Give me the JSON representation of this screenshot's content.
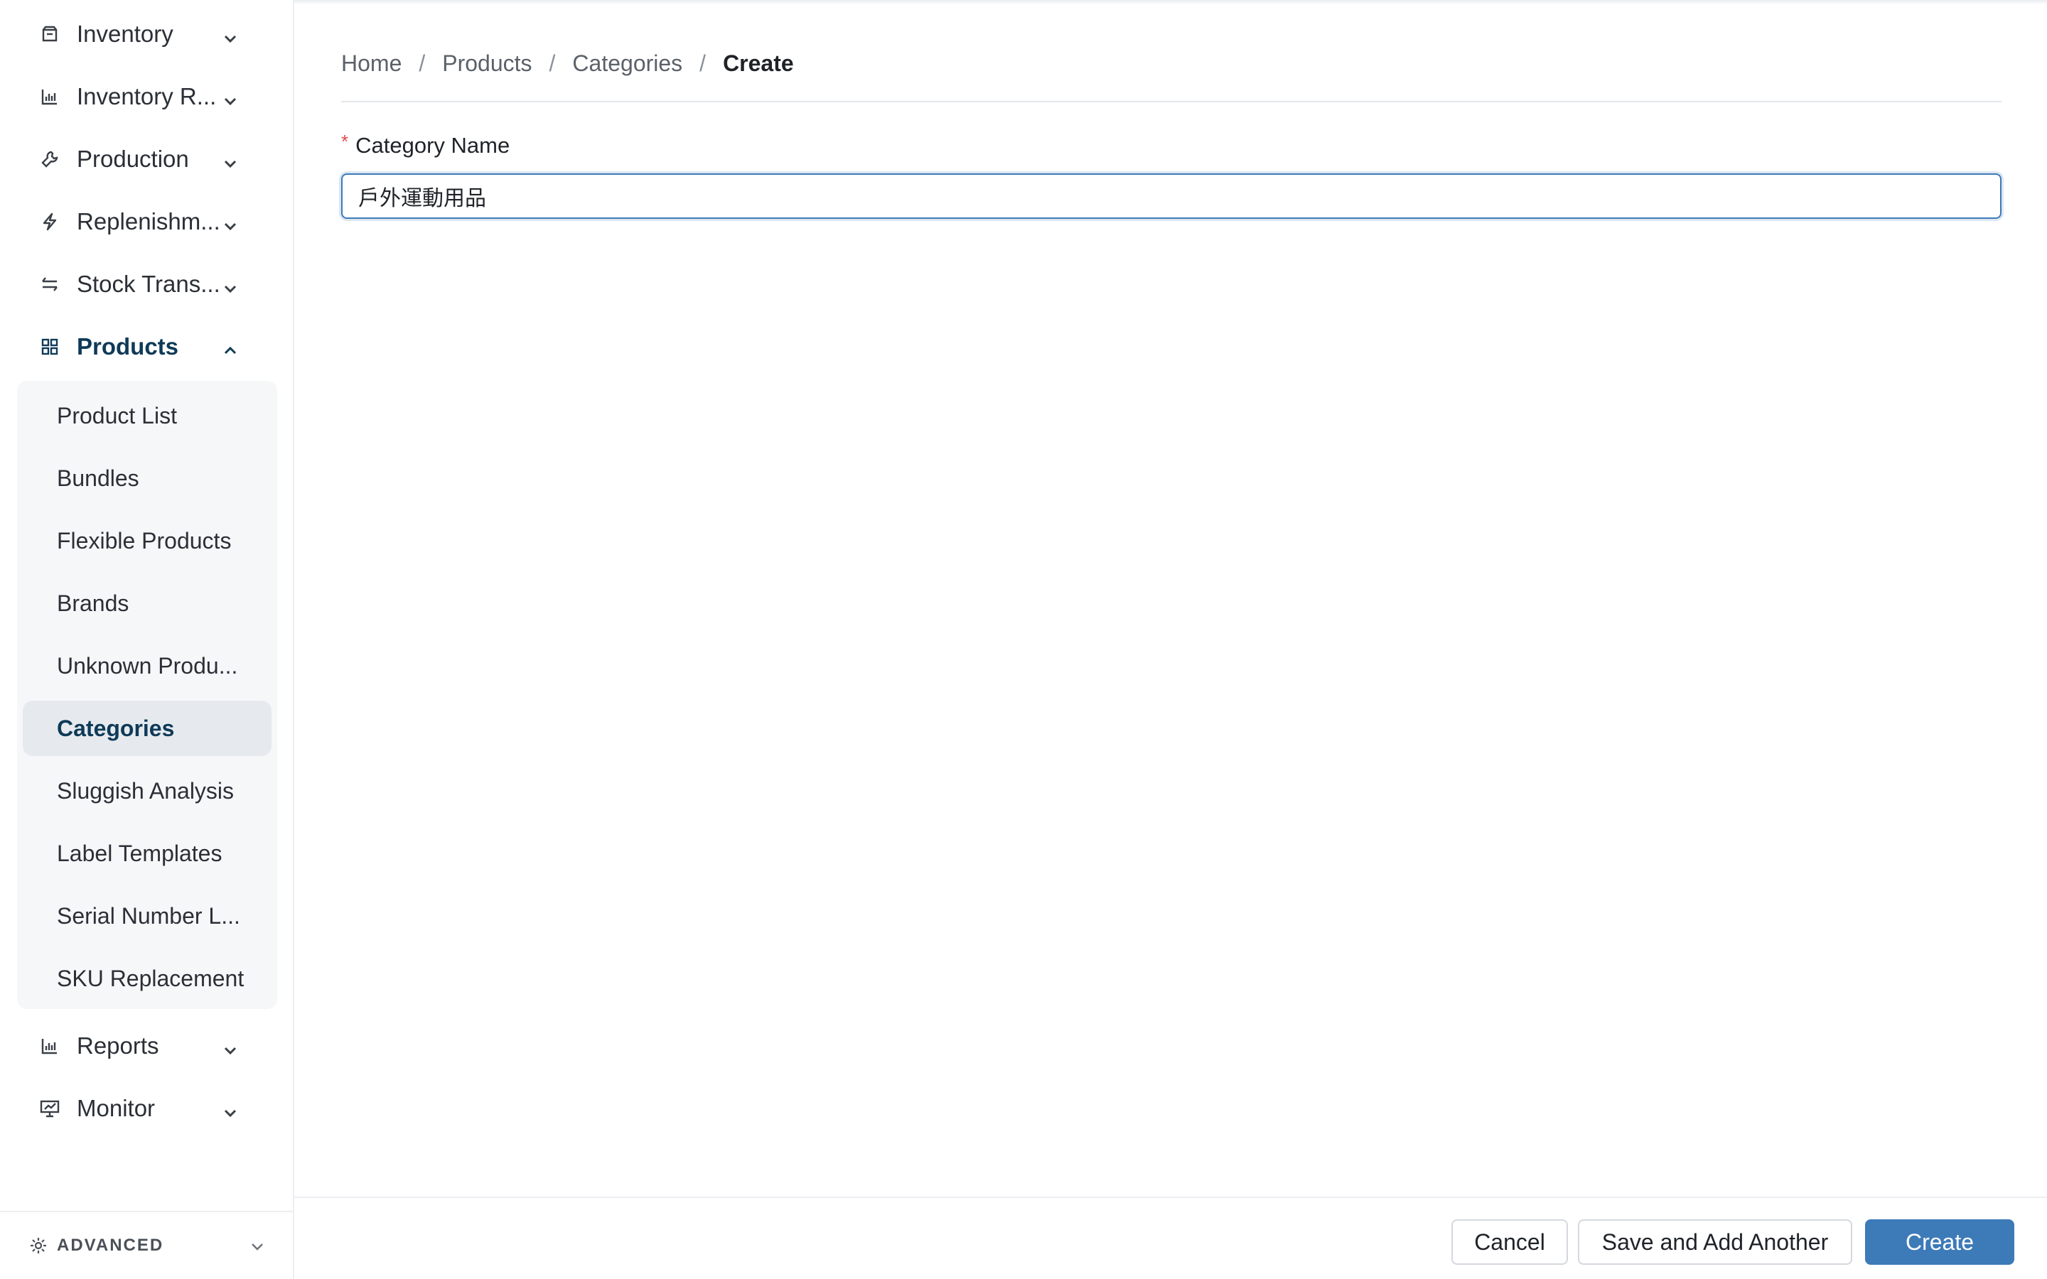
{
  "sidebar": {
    "items": [
      {
        "label": "Inventory",
        "icon": "box-icon"
      },
      {
        "label": "Inventory R...",
        "icon": "bar-chart-icon"
      },
      {
        "label": "Production",
        "icon": "wrench-icon"
      },
      {
        "label": "Replenishm...",
        "icon": "lightning-icon"
      },
      {
        "label": "Stock Trans...",
        "icon": "transfer-icon"
      },
      {
        "label": "Products",
        "icon": "grid-icon"
      },
      {
        "label": "Reports",
        "icon": "bar-chart-icon"
      },
      {
        "label": "Monitor",
        "icon": "monitor-chart-icon"
      }
    ],
    "products_submenu": [
      {
        "label": "Product List"
      },
      {
        "label": "Bundles"
      },
      {
        "label": "Flexible Products"
      },
      {
        "label": "Brands"
      },
      {
        "label": "Unknown Produ..."
      },
      {
        "label": "Categories",
        "active": true
      },
      {
        "label": "Sluggish Analysis"
      },
      {
        "label": "Label Templates"
      },
      {
        "label": "Serial Number L..."
      },
      {
        "label": "SKU Replacement"
      }
    ],
    "advanced_label": "ADVANCED"
  },
  "breadcrumb": {
    "home": "Home",
    "products": "Products",
    "categories": "Categories",
    "current": "Create",
    "separator": "/"
  },
  "form": {
    "category_name_label": "Category Name",
    "required_mark": "*",
    "category_name_value": "戶外運動用品"
  },
  "footer": {
    "cancel_label": "Cancel",
    "save_another_label": "Save and Add Another",
    "create_label": "Create"
  },
  "colors": {
    "primary": "#3d7ab8",
    "active_nav": "#0f3a58",
    "required": "#e5484d"
  }
}
